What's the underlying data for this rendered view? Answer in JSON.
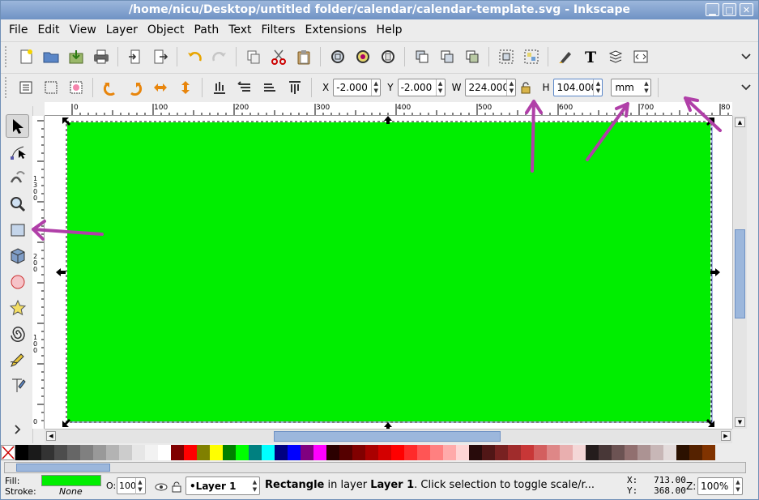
{
  "window": {
    "title": "/home/nicu/Desktop/untitled folder/calendar/calendar-template.svg - Inkscape"
  },
  "menu": [
    "File",
    "Edit",
    "View",
    "Layer",
    "Object",
    "Path",
    "Text",
    "Filters",
    "Extensions",
    "Help"
  ],
  "controls": {
    "x_label": "X",
    "x_value": "-2.000",
    "y_label": "Y",
    "y_value": "-2.000",
    "w_label": "W",
    "w_value": "224.000",
    "h_label": "H",
    "h_value": "104.000",
    "unit": "mm"
  },
  "rulers": {
    "h_ticks": [
      "0",
      "100",
      "200",
      "300",
      "400",
      "500",
      "600",
      "700",
      "80"
    ],
    "v_ticks": [
      "1",
      "3",
      "0",
      "0",
      "2",
      "0",
      "0",
      "1",
      "0",
      "0",
      "0"
    ]
  },
  "status": {
    "fill_label": "Fill:",
    "stroke_label": "Stroke:",
    "stroke_value": "None",
    "fill_color": "#00ee00",
    "opacity_label": "O:",
    "opacity_value": "100",
    "layer": "•Layer 1",
    "message_bold": "Rectangle",
    "message_mid": " in layer ",
    "message_layer": "Layer 1",
    "message_rest": ". Click selection to toggle scale/r...",
    "x_coord": "X:   713.00",
    "y_coord": "Y:   368.00",
    "zoom_label": "Z:",
    "zoom_value": "100%"
  },
  "colors": {
    "accent": "#00ee00",
    "annotation": "#b03fa8",
    "title_bar": "#7b9cce"
  },
  "palette": [
    "#000000",
    "#1a1a1a",
    "#333333",
    "#4d4d4d",
    "#666666",
    "#808080",
    "#999999",
    "#b3b3b3",
    "#cccccc",
    "#e6e6e6",
    "#f2f2f2",
    "#ffffff",
    "#800000",
    "#ff0000",
    "#808000",
    "#ffff00",
    "#008000",
    "#00ff00",
    "#008080",
    "#00ffff",
    "#000080",
    "#0000ff",
    "#800080",
    "#ff00ff",
    "#2b0000",
    "#550000",
    "#800000",
    "#aa0000",
    "#d40000",
    "#ff0000",
    "#ff2a2a",
    "#ff5555",
    "#ff8080",
    "#ffaaaa",
    "#ffd5d5",
    "#280b0b",
    "#501616",
    "#782121",
    "#a02c2c",
    "#c83737",
    "#d35f5f",
    "#de8787",
    "#e9afaf",
    "#f4d7d7",
    "#241c1c",
    "#483737",
    "#6c5353",
    "#916f6f",
    "#ac9393",
    "#c8b7b7",
    "#e3dbdb",
    "#2b1100",
    "#552200",
    "#803300"
  ]
}
